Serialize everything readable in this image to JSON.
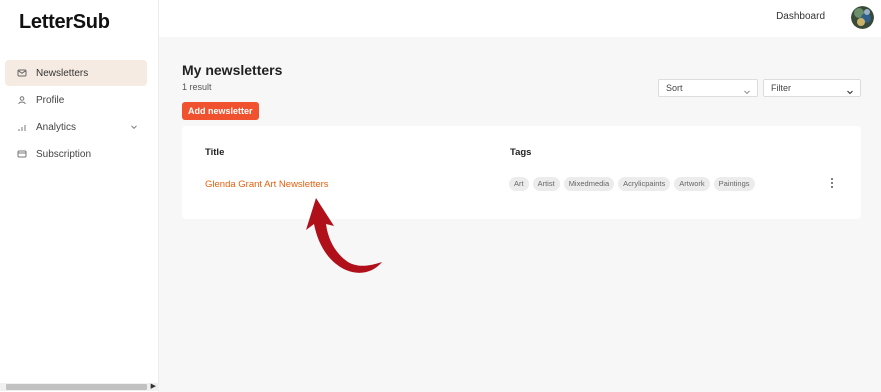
{
  "app": {
    "logo": "LetterSub"
  },
  "sidebar": {
    "items": [
      {
        "label": "Newsletters",
        "icon": "mail-icon",
        "active": true
      },
      {
        "label": "Profile",
        "icon": "user-icon"
      },
      {
        "label": "Analytics",
        "icon": "bar-chart-icon",
        "expandable": true
      },
      {
        "label": "Subscription",
        "icon": "card-icon"
      }
    ]
  },
  "topbar": {
    "dashboard_label": "Dashboard",
    "avatar": "user-avatar"
  },
  "main": {
    "title": "My newsletters",
    "result_count": "1 result",
    "add_button": "Add newsletter",
    "sort": {
      "value": "Sort"
    },
    "filter": {
      "value": "Filter"
    },
    "table": {
      "headers": {
        "title": "Title",
        "tags": "Tags"
      },
      "rows": [
        {
          "title": "Glenda Grant Art Newsletters",
          "tags": [
            "Art",
            "Artist",
            "Mixedmedia",
            "Acrylicpaints",
            "Artwork",
            "Paintings"
          ]
        }
      ]
    }
  },
  "colors": {
    "accent": "#f0522f",
    "link": "#e8600e",
    "active_nav": "#f6ebe2",
    "annotation_arrow": "#b0101a"
  }
}
